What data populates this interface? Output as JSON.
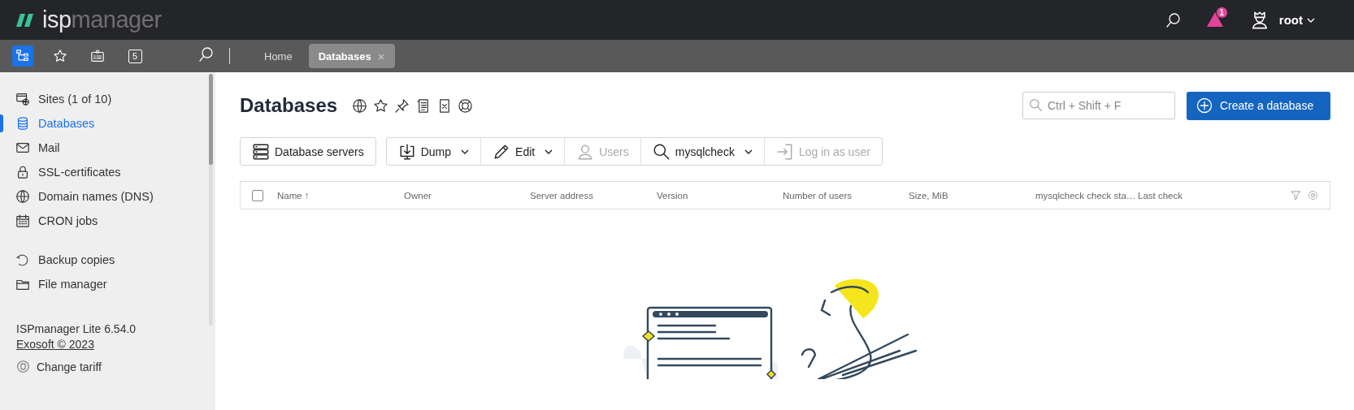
{
  "header": {
    "logo_prefix": "isp",
    "logo_suffix": "manager",
    "notifications": "1",
    "user": "root"
  },
  "panel_buttons": [
    {
      "kind": "tree",
      "selected": true
    },
    {
      "kind": "star",
      "selected": false
    },
    {
      "kind": "clipboard",
      "selected": false
    },
    {
      "kind": "counter",
      "label": "5",
      "selected": false
    }
  ],
  "tabs": [
    {
      "label": "Home",
      "selected": false
    },
    {
      "label": "Databases",
      "selected": true,
      "close": "×"
    }
  ],
  "sidebar": {
    "groups": [
      [
        {
          "label": "Sites (1 of 10)",
          "kind": "sites",
          "selected": false
        },
        {
          "label": "Databases",
          "kind": "db",
          "selected": true
        },
        {
          "label": "Mail",
          "kind": "mail",
          "selected": false
        },
        {
          "label": "SSL-certificates",
          "kind": "lock",
          "selected": false
        },
        {
          "label": "Domain names (DNS)",
          "kind": "globe",
          "selected": false
        },
        {
          "label": "CRON jobs",
          "kind": "calendar",
          "selected": false
        }
      ],
      [
        {
          "label": "Backup copies",
          "kind": "backup",
          "selected": false
        },
        {
          "label": "File manager",
          "kind": "folder",
          "selected": false
        }
      ]
    ],
    "version": "ISPmanager Lite 6.54.0",
    "copyright": "Exosoft © 2023",
    "tariff": "Change tariff"
  },
  "page": {
    "title": "Databases",
    "search": {
      "placeholder": "Ctrl + Shift + F"
    },
    "create_button": "Create a database"
  },
  "toolbar": [
    [
      {
        "label": "Database servers",
        "kind": "servers",
        "dropdown": false,
        "disabled": false
      }
    ],
    [
      {
        "label": "Dump",
        "kind": "dump",
        "dropdown": true,
        "disabled": false
      },
      {
        "label": "Edit",
        "kind": "edit",
        "dropdown": true,
        "disabled": false
      },
      {
        "label": "Users",
        "kind": "user",
        "dropdown": false,
        "disabled": true
      },
      {
        "label": "mysqlcheck",
        "kind": "search",
        "dropdown": true,
        "disabled": false
      },
      {
        "label": "Log in as user",
        "kind": "login",
        "dropdown": false,
        "disabled": true
      }
    ]
  ],
  "table": {
    "select_all": {
      "checked": false
    },
    "columns": [
      "Name ↑",
      "Owner",
      "Server address",
      "Version",
      "Number of users",
      "Size, MiB",
      "mysqlcheck check sta…",
      "Last check"
    ]
  },
  "empty_state": {
    "kind": "picture"
  }
}
